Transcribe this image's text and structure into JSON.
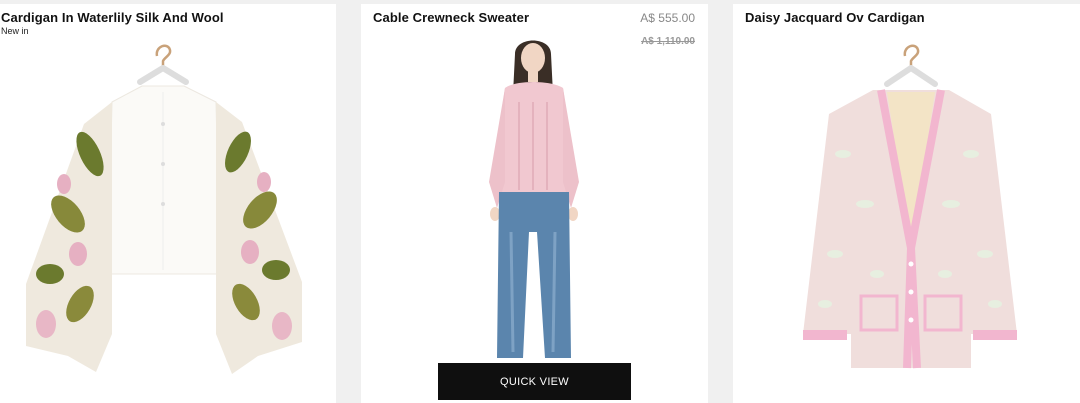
{
  "products": [
    {
      "name": "Cardigan In Waterlily Silk And Wool",
      "badge": "New in"
    },
    {
      "name": "Cable Crewneck Sweater",
      "price": "A$ 555.00",
      "original_price": "A$ 1,110.00",
      "quick_view_label": "QUICK VIEW"
    },
    {
      "name": "Daisy Jacquard Ov Cardigan"
    }
  ],
  "colors": {
    "page_background": "#f0f0f0",
    "card_background": "#ffffff",
    "quick_view_background": "#0f0f0f",
    "price_text": "#888888"
  }
}
